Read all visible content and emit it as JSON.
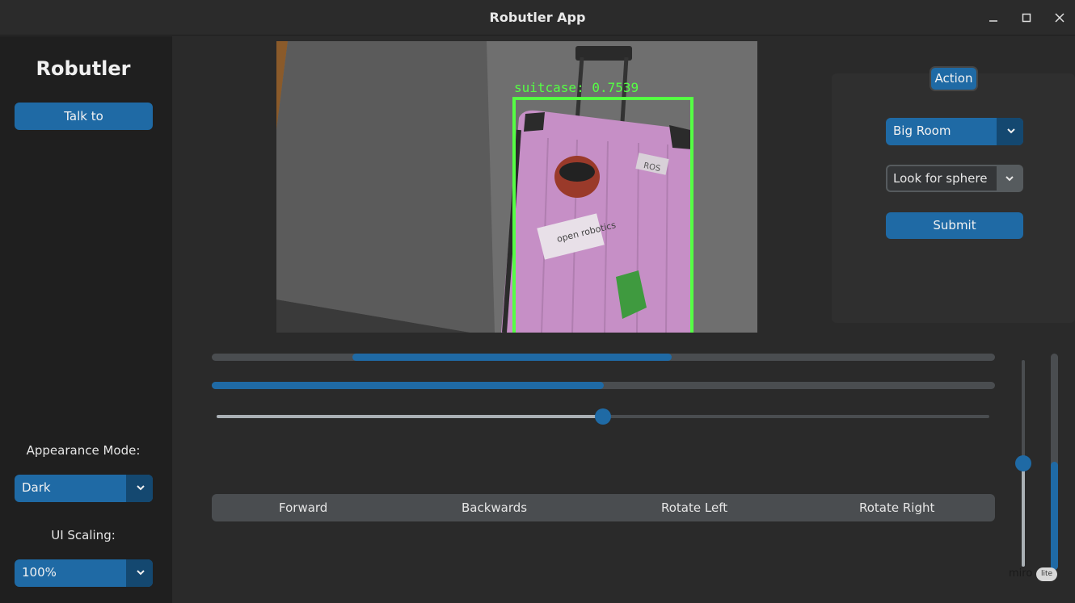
{
  "window": {
    "title": "Robutler App",
    "minimize": "–",
    "maximize": "☐",
    "close": "✕"
  },
  "sidebar": {
    "logo": "Robutler",
    "talk_button": "Talk to",
    "appearance_label": "Appearance Mode:",
    "appearance_value": "Dark",
    "scaling_label": "UI Scaling:",
    "scaling_value": "100%"
  },
  "camera": {
    "detection_label": "suitcase: 0.7539",
    "sticker_text": "open robotics",
    "sticker_text2": "ROS"
  },
  "action_panel": {
    "tab_label": "Action",
    "room_value": "Big Room",
    "task_value": "Look for sphere",
    "submit_label": "Submit"
  },
  "controls": {
    "progress_top_start": 0.18,
    "progress_top_end": 0.587,
    "progress_middle": 0.5,
    "slider_horizontal": 0.5,
    "slider_vertical": 0.5,
    "progress_vertical": 0.5,
    "segments": [
      "Forward",
      "Backwards",
      "Rotate Left",
      "Rotate Right"
    ]
  },
  "overlay": {
    "brand": "miro",
    "badge": "lite"
  },
  "colors": {
    "accent": "#1f6aa5",
    "detection_box": "#55ff44",
    "suitcase": "#c88fc8"
  }
}
